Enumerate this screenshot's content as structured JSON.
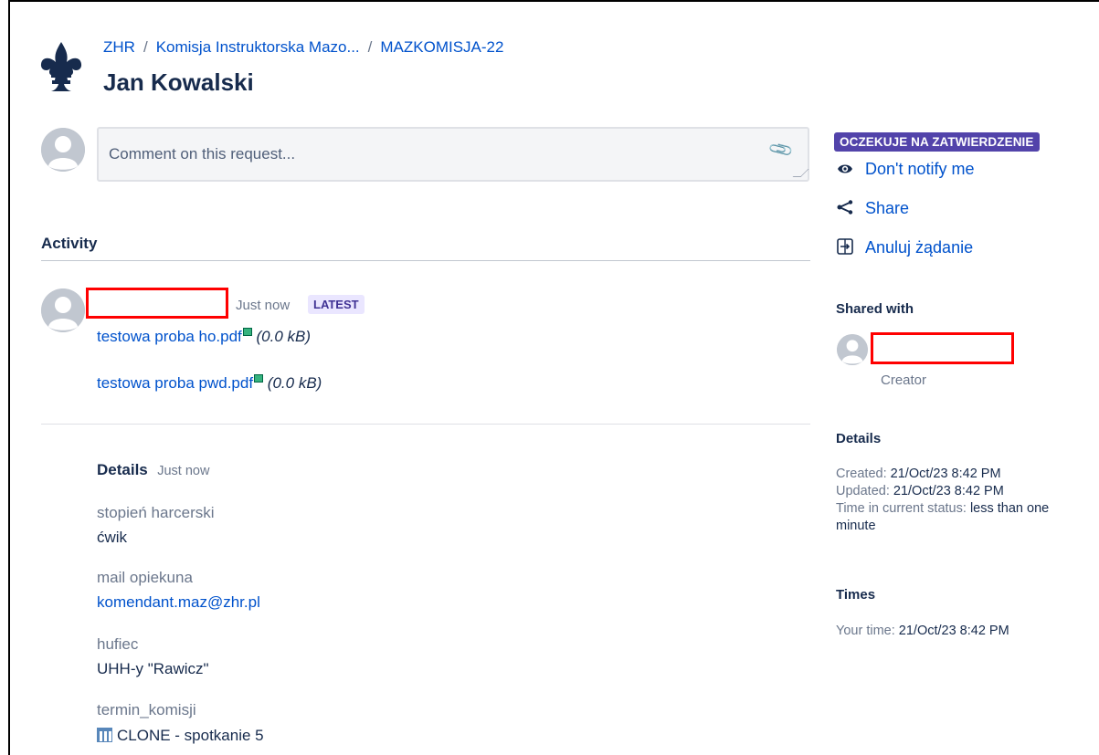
{
  "header": {
    "breadcrumbs": [
      "ZHR",
      "Komisja Instruktorska Mazo...",
      "MAZKOMISJA-22"
    ],
    "separator": "/",
    "title": "Jan Kowalski"
  },
  "comment": {
    "placeholder": "Comment on this request..."
  },
  "activity": {
    "heading": "Activity",
    "entry": {
      "time": "Just now",
      "badge": "LATEST",
      "attachments": [
        {
          "name": "testowa proba ho.pdf",
          "size": "(0.0 kB)"
        },
        {
          "name": "testowa proba pwd.pdf",
          "size": "(0.0 kB)"
        }
      ]
    },
    "details": {
      "heading": "Details",
      "time": "Just now",
      "fields": [
        {
          "label": "stopień harcerski",
          "value": "ćwik"
        },
        {
          "label": "mail opiekuna",
          "value": "komendant.maz@zhr.pl"
        },
        {
          "label": "hufiec",
          "value": "UHH-y \"Rawicz\""
        },
        {
          "label": "termin_komisji",
          "value": "CLONE - spotkanie 5"
        }
      ]
    }
  },
  "sidebar": {
    "status": "OCZEKUJE NA ZATWIERDZENIE",
    "actions": [
      {
        "label": "Don't notify me",
        "icon": "eye-icon"
      },
      {
        "label": "Share",
        "icon": "share-icon"
      },
      {
        "label": "Anuluj żądanie",
        "icon": "cancel-request-icon"
      }
    ],
    "shared_with": {
      "heading": "Shared with",
      "role": "Creator"
    },
    "details": {
      "heading": "Details",
      "created_label": "Created:",
      "created_value": "21/Oct/23 8:42 PM",
      "updated_label": "Updated:",
      "updated_value": "21/Oct/23 8:42 PM",
      "status_time_label": "Time in current status:",
      "status_time_value": "less than one minute"
    },
    "times": {
      "heading": "Times",
      "your_time_label": "Your time:",
      "your_time_value": "21/Oct/23 8:42 PM"
    }
  },
  "colors": {
    "link": "#0052cc",
    "status_lozenge": "#5243aa",
    "latest_badge_bg": "#eae6ff",
    "redaction": "#ff0000"
  }
}
